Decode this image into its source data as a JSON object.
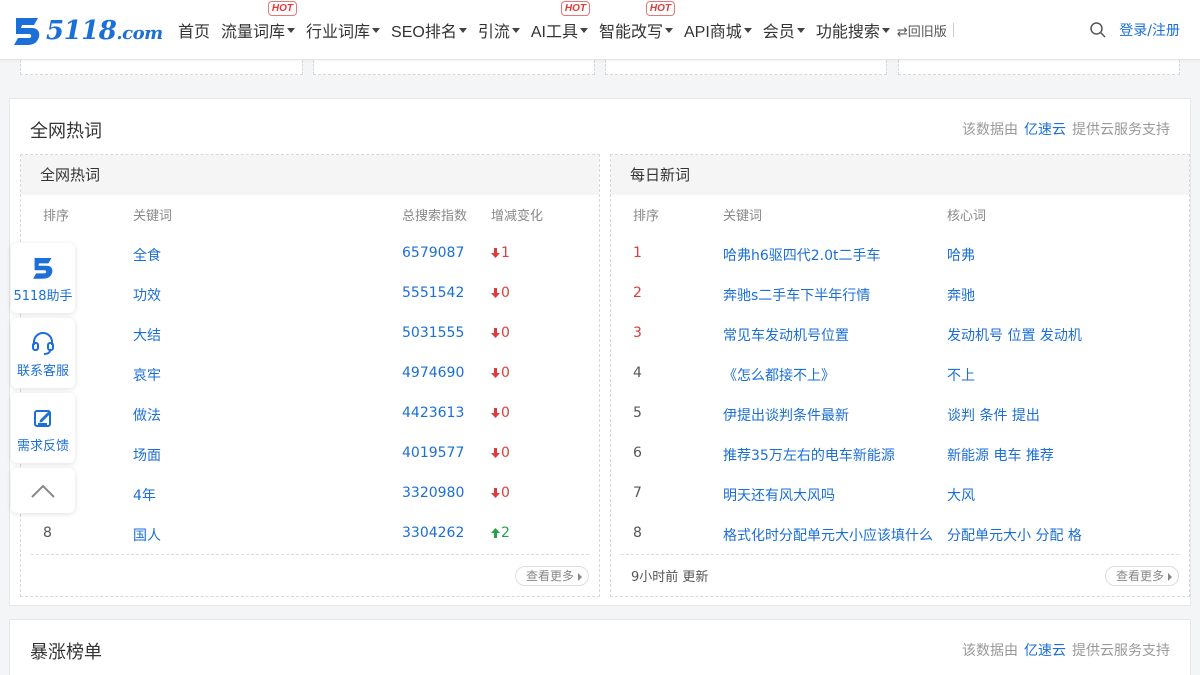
{
  "nav": {
    "logo_text": "5118",
    "logo_domain": ".com",
    "items": [
      {
        "label": "首页",
        "caret": false,
        "hot": false
      },
      {
        "label": "流量词库",
        "caret": true,
        "hot": true
      },
      {
        "label": "行业词库",
        "caret": true,
        "hot": false
      },
      {
        "label": "SEO排名",
        "caret": true,
        "hot": false
      },
      {
        "label": "引流",
        "caret": true,
        "hot": false
      },
      {
        "label": "AI工具",
        "caret": true,
        "hot": true
      },
      {
        "label": "智能改写",
        "caret": true,
        "hot": true
      },
      {
        "label": "API商城",
        "caret": true,
        "hot": false
      },
      {
        "label": "会员",
        "caret": true,
        "hot": false
      },
      {
        "label": "功能搜索",
        "caret": true,
        "hot": false
      }
    ],
    "hot_badge": "HOT",
    "old_version": "⇄回旧版",
    "login": "登录/注册"
  },
  "hotwords_panel": {
    "title": "全网热词",
    "source_prefix": "该数据由",
    "source_brand": "亿速云",
    "source_suffix": "提供云服务支持",
    "left": {
      "title": "全网热词",
      "columns": [
        "排序",
        "关键词",
        "总搜索指数",
        "增减变化"
      ],
      "rows": [
        {
          "rank": "",
          "keyword": "全食",
          "index": "6579087",
          "dir": "down",
          "change": "1"
        },
        {
          "rank": "",
          "keyword": "功效",
          "index": "5551542",
          "dir": "down",
          "change": "0"
        },
        {
          "rank": "",
          "keyword": "大结",
          "index": "5031555",
          "dir": "down",
          "change": "0"
        },
        {
          "rank": "",
          "keyword": "哀牢",
          "index": "4974690",
          "dir": "down",
          "change": "0"
        },
        {
          "rank": "",
          "keyword": "做法",
          "index": "4423613",
          "dir": "down",
          "change": "0"
        },
        {
          "rank": "",
          "keyword": "场面",
          "index": "4019577",
          "dir": "down",
          "change": "0"
        },
        {
          "rank": "",
          "keyword": "4年",
          "index": "3320980",
          "dir": "down",
          "change": "0"
        },
        {
          "rank": "8",
          "keyword": "国人",
          "index": "3304262",
          "dir": "up",
          "change": "2"
        }
      ],
      "more": "查看更多"
    },
    "right": {
      "title": "每日新词",
      "columns": [
        "排序",
        "关键词",
        "核心词"
      ],
      "rows": [
        {
          "rank": "1",
          "keyword": "哈弗h6驱四代2.0t二手车",
          "core": "哈弗"
        },
        {
          "rank": "2",
          "keyword": "奔驰s二手车下半年行情",
          "core": "奔驰"
        },
        {
          "rank": "3",
          "keyword": "常见车发动机号位置",
          "core": "发动机号 位置 发动机"
        },
        {
          "rank": "4",
          "keyword": "《怎么都接不上》",
          "core": "不上"
        },
        {
          "rank": "5",
          "keyword": "伊提出谈判条件最新",
          "core": "谈判 条件 提出"
        },
        {
          "rank": "6",
          "keyword": "推荐35万左右的电车新能源",
          "core": "新能源 电车 推荐"
        },
        {
          "rank": "7",
          "keyword": "明天还有风大风吗",
          "core": "大风"
        },
        {
          "rank": "8",
          "keyword": "格式化时分配单元大小应该填什么",
          "core": "分配单元大小 分配 格"
        }
      ],
      "updated": "9小时前 更新",
      "more": "查看更多"
    }
  },
  "surge_panel": {
    "title": "暴涨榜单",
    "source_prefix": "该数据由",
    "source_brand": "亿速云",
    "source_suffix": "提供云服务支持"
  },
  "float_bar": {
    "assistant": "5118助手",
    "service": "联系客服",
    "feedback": "需求反馈"
  },
  "colors": {
    "brand": "#1b6fd6",
    "down": "#e03a3a",
    "up": "#22a34a"
  }
}
